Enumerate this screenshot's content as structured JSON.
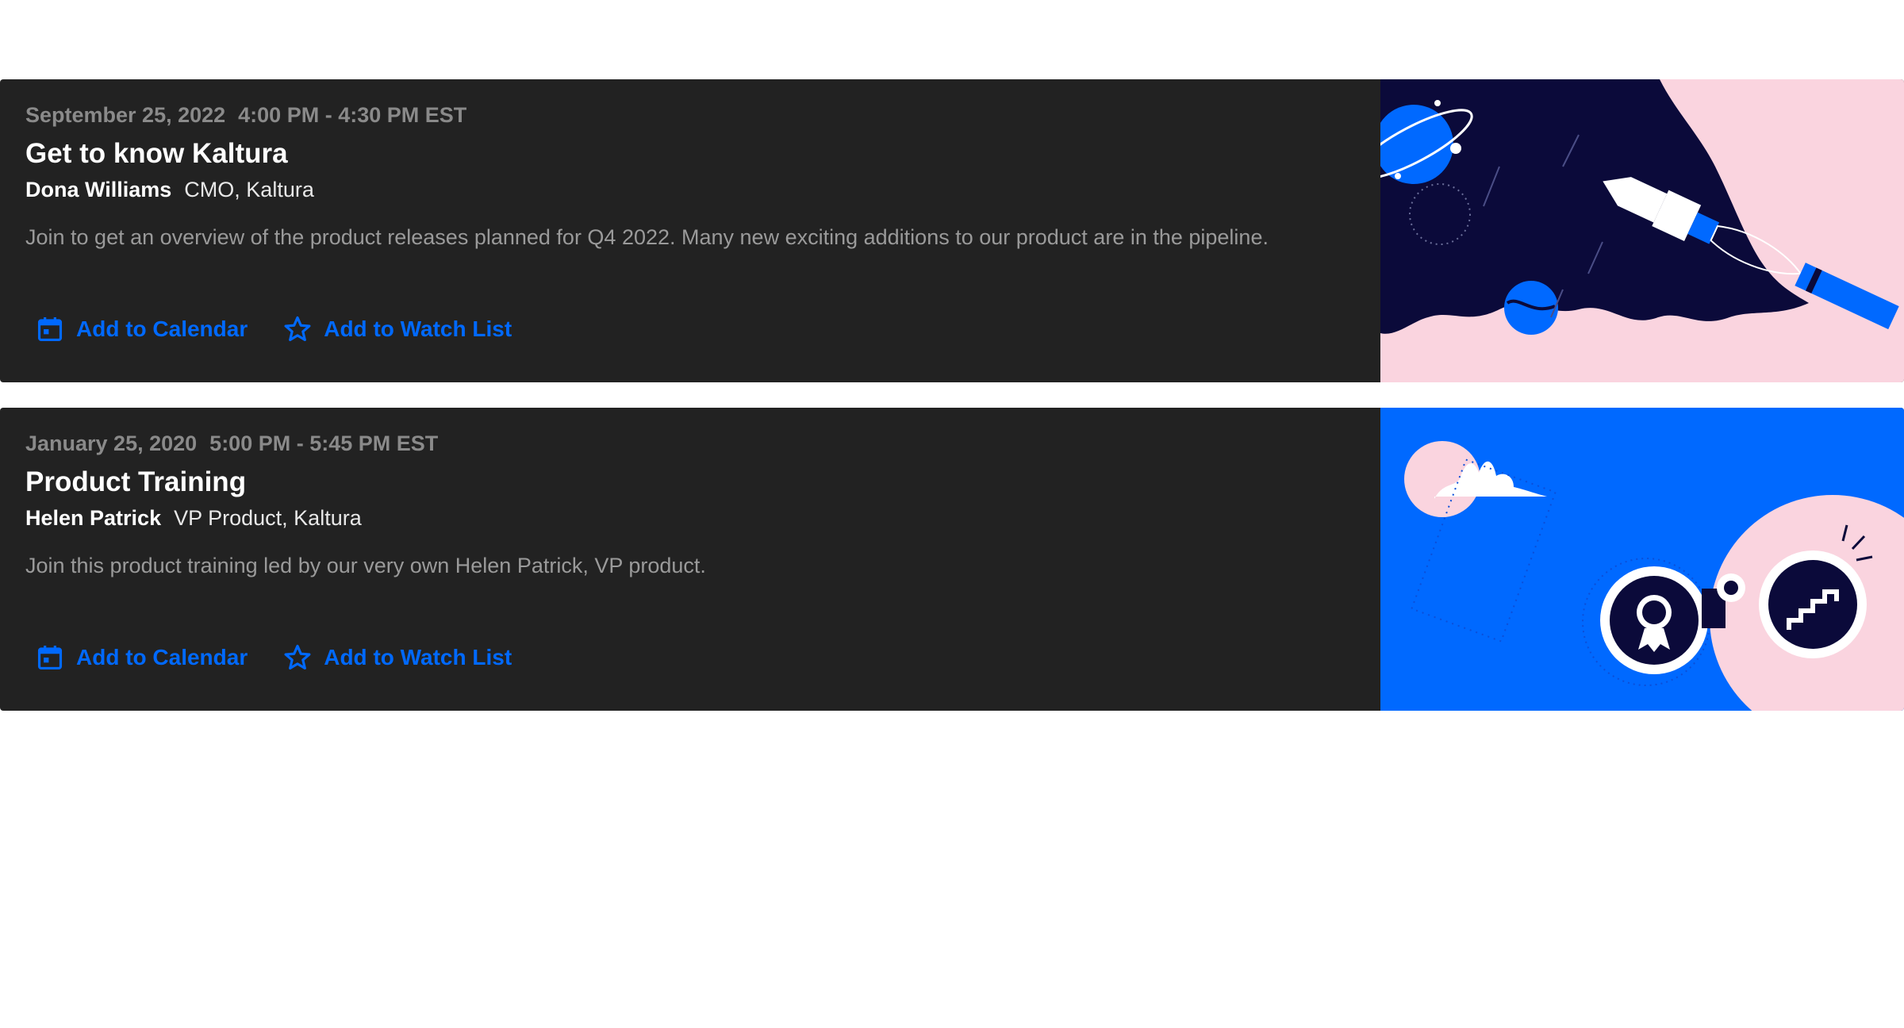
{
  "colors": {
    "card_bg": "#222222",
    "accent": "#0069ff",
    "muted_text": "#8a8a8a",
    "thumb_dark": "#0b0a3a",
    "thumb_pink": "#fad4df"
  },
  "sessions": [
    {
      "date": "September 25, 2022",
      "time": "4:00 PM - 4:30 PM EST",
      "title": "Get to know Kaltura",
      "speaker_name": "Dona Williams",
      "speaker_role": "CMO, Kaltura",
      "description": "Join to get an overview of the product releases planned for Q4 2022. Many new exciting additions to our product are in the pipeline.",
      "calendar_label": "Add to Calendar",
      "calendar_icon": "calendar-icon",
      "watchlist_label": "Add to Watch List",
      "watchlist_icon": "star-icon",
      "thumbnail": "space-rocket-illustration"
    },
    {
      "date": "January 25, 2020",
      "time": "5:00 PM - 5:45 PM EST",
      "title": "Product Training",
      "speaker_name": "Helen Patrick",
      "speaker_role": "VP Product, Kaltura",
      "description": "Join this product training led by our very own Helen Patrick, VP product.",
      "calendar_label": "Add to Calendar",
      "calendar_icon": "calendar-icon",
      "watchlist_label": "Add to Watch List",
      "watchlist_icon": "star-icon",
      "thumbnail": "binoculars-illustration"
    }
  ]
}
